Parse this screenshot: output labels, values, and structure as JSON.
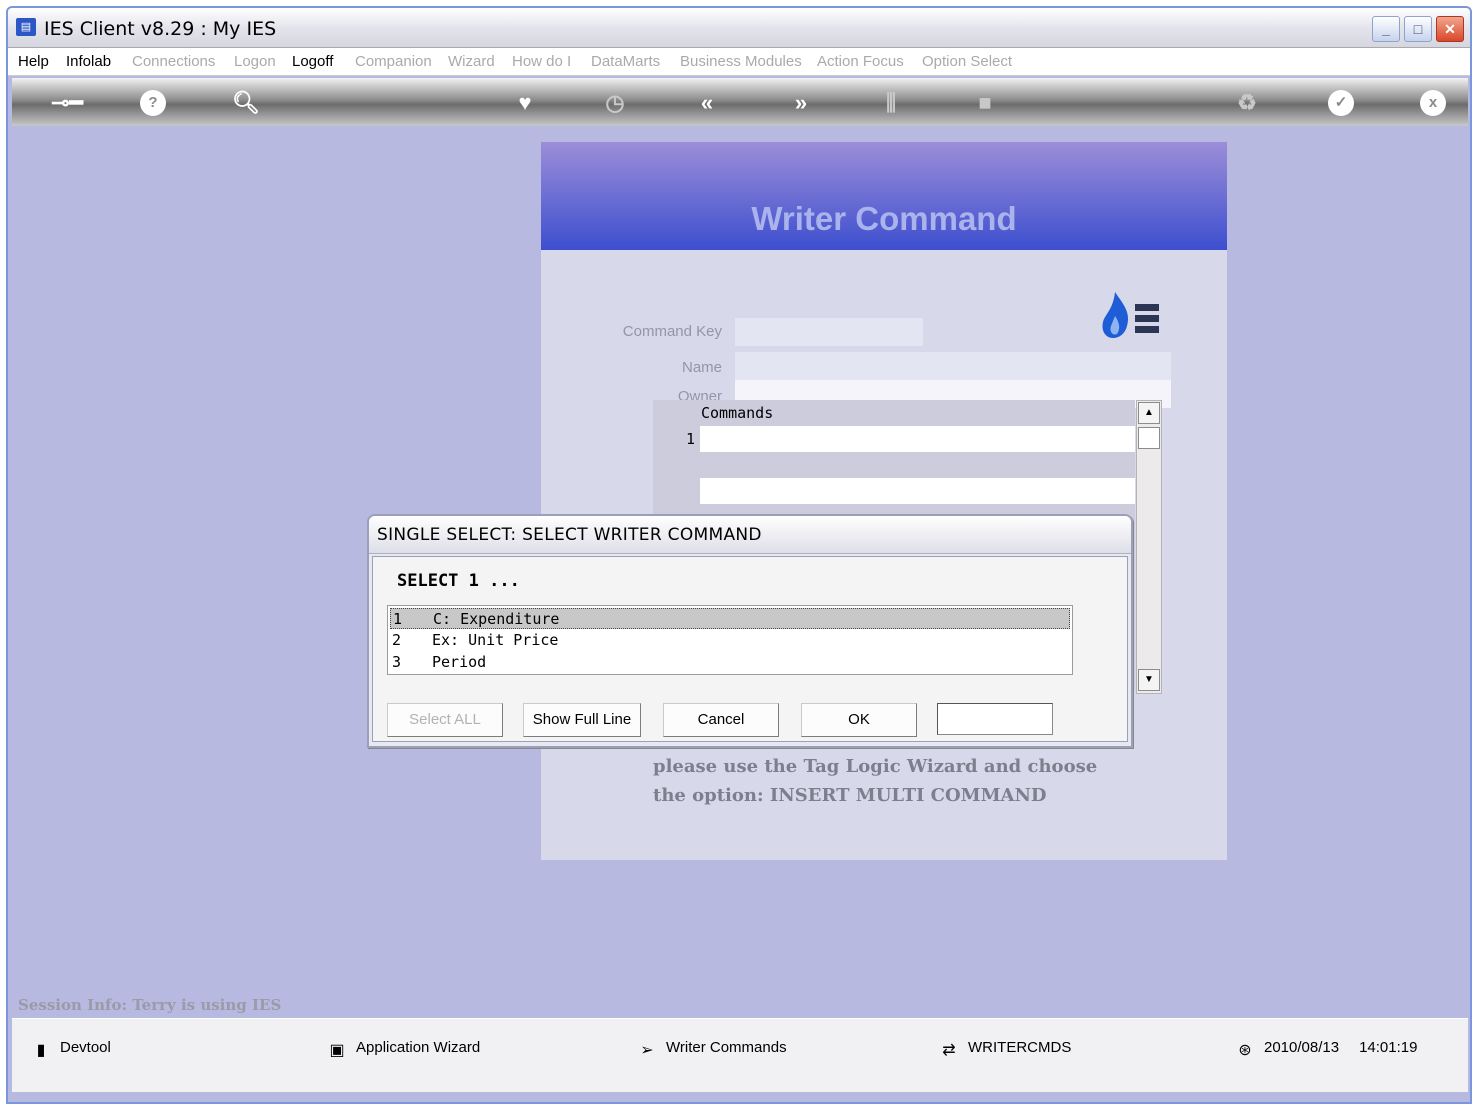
{
  "window": {
    "title": "IES Client v8.29 : My IES",
    "controls": [
      "minimize-icon",
      "restore-icon",
      "close-icon"
    ]
  },
  "menubar": {
    "items": [
      {
        "label": "Help",
        "enabled": true
      },
      {
        "label": "Infolab",
        "enabled": true
      },
      {
        "label": "Connections",
        "enabled": false
      },
      {
        "label": "Logon",
        "enabled": false
      },
      {
        "label": "Logoff",
        "enabled": true
      },
      {
        "label": "Companion",
        "enabled": false
      },
      {
        "label": "Wizard",
        "enabled": false
      },
      {
        "label": "How do I",
        "enabled": false
      },
      {
        "label": "DataMarts",
        "enabled": false
      },
      {
        "label": "Business Modules",
        "enabled": false
      },
      {
        "label": "Action Focus",
        "enabled": false
      },
      {
        "label": "Option Select",
        "enabled": false
      }
    ]
  },
  "toolbar": {
    "icons": [
      "key-icon",
      "help-icon",
      "search-icon",
      "heart-icon",
      "clock-icon",
      "rewind-icon",
      "fast-forward-icon",
      "tree-icon",
      "stop-icon",
      "recycle-icon",
      "check-icon",
      "close-icon"
    ]
  },
  "panel": {
    "title": "Writer Command",
    "fields": {
      "command_key_label": "Command Key",
      "command_key_value": "",
      "name_label": "Name",
      "name_value": "",
      "owner_label": "Owner",
      "owner_value": ""
    },
    "grid": {
      "header": "Commands",
      "rows": [
        {
          "num": "1",
          "value": ""
        }
      ]
    },
    "hint_line1": "please use the Tag Logic Wizard and choose",
    "hint_line2": "the option: INSERT MULTI COMMAND"
  },
  "dialog": {
    "title": "SINGLE SELECT: SELECT WRITER COMMAND",
    "prompt": "SELECT 1 ...",
    "items": [
      {
        "num": "1",
        "label": "C: Expenditure",
        "selected": true
      },
      {
        "num": "2",
        "label": "Ex: Unit Price",
        "selected": false
      },
      {
        "num": "3",
        "label": "Period",
        "selected": false
      }
    ],
    "buttons": {
      "select_all": "Select ALL",
      "show_full_line": "Show Full Line",
      "cancel": "Cancel",
      "ok": "OK"
    },
    "input_value": ""
  },
  "session_info": "Session Info: Terry is using IES",
  "statusbar": {
    "devtool": "Devtool",
    "app_wizard": "Application Wizard",
    "writer_commands": "Writer Commands",
    "writercmds": "WRITERCMDS",
    "date": "2010/08/13",
    "time": "14:01:19"
  },
  "colors": {
    "accent": "#3d4fcf",
    "background": "#b7b9e0",
    "panel": "#d7d8ea"
  }
}
